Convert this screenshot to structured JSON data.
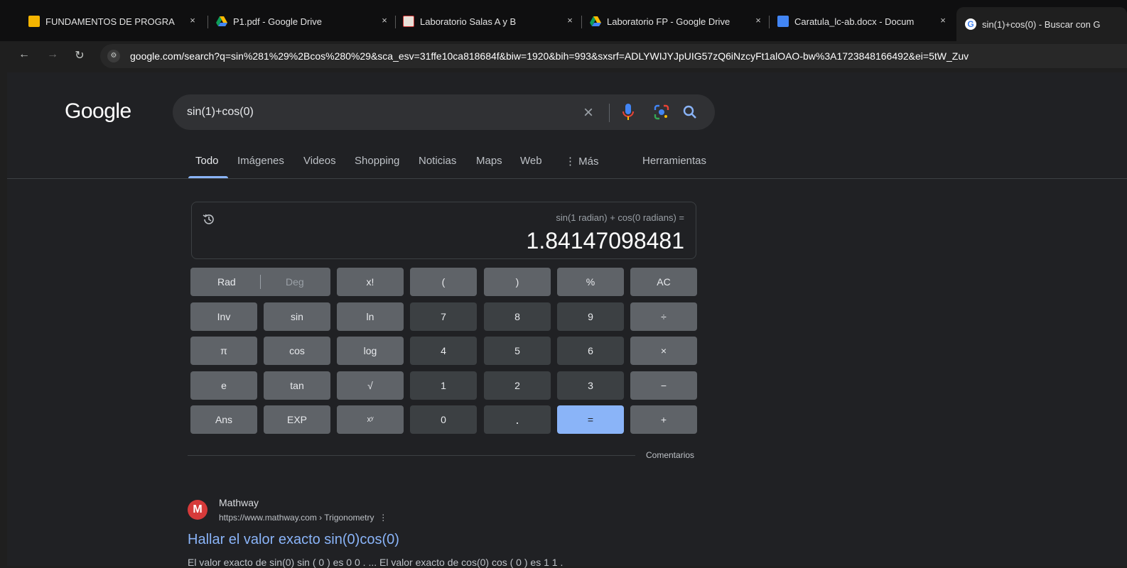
{
  "browser": {
    "tabs": [
      {
        "title": "FUNDAMENTOS DE PROGRA",
        "icon": "classroom-icon"
      },
      {
        "title": "P1.pdf - Google Drive",
        "icon": "drive-icon"
      },
      {
        "title": "Laboratorio Salas A y B",
        "icon": "site-icon"
      },
      {
        "title": "Laboratorio FP - Google Drive",
        "icon": "drive-icon"
      },
      {
        "title": "Caratula_lc-ab.docx - Docum",
        "icon": "docs-icon"
      },
      {
        "title": "sin(1)+cos(0) - Buscar con G",
        "icon": "google-icon"
      }
    ],
    "close_glyph": "×",
    "url_domain": "google.com",
    "url_rest": "/search?q=sin%281%29%2Bcos%280%29&sca_esv=31ffe10ca818684f&biw=1920&bih=993&sxsrf=ADLYWIJYJpUIG57zQ6iNzcyFt1alOAO-bw%3A1723848166492&ei=5tW_Zuv"
  },
  "search": {
    "logo": "Google",
    "query": "sin(1)+cos(0)",
    "clear_glyph": "×",
    "tabs": [
      "Todo",
      "Imágenes",
      "Videos",
      "Shopping",
      "Noticias",
      "Maps",
      "Web",
      "⋮ Más"
    ],
    "tools": "Herramientas"
  },
  "calculator": {
    "expression": "sin(1 radian) + cos(0 radians) =",
    "result": "1.84147098481",
    "rad": "Rad",
    "deg": "Deg",
    "keys": [
      "x!",
      "(",
      ")",
      "%",
      "AC",
      "Inv",
      "sin",
      "ln",
      "7",
      "8",
      "9",
      "÷",
      "π",
      "cos",
      "log",
      "4",
      "5",
      "6",
      "×",
      "e",
      "tan",
      "√",
      "1",
      "2",
      "3",
      "−",
      "Ans",
      "EXP",
      "xʸ",
      "0",
      ".",
      "=",
      "+"
    ],
    "feedback": "Comentarios"
  },
  "result": {
    "site": "Mathway",
    "logo_letter": "M",
    "breadcrumb": "https://www.mathway.com › Trigonometry",
    "more_glyph": "⋮",
    "title": "Hallar el valor exacto sin(0)cos(0)",
    "snippet": "El valor exacto de sin(0) sin ( 0 ) es 0 0 . ... El valor exacto de cos(0) cos ( 0 ) es 1 1 ."
  },
  "colors": {
    "accent": "#8ab4f8",
    "fn_key": "#5f6368",
    "num_key": "#3c4043",
    "background": "#202124"
  }
}
